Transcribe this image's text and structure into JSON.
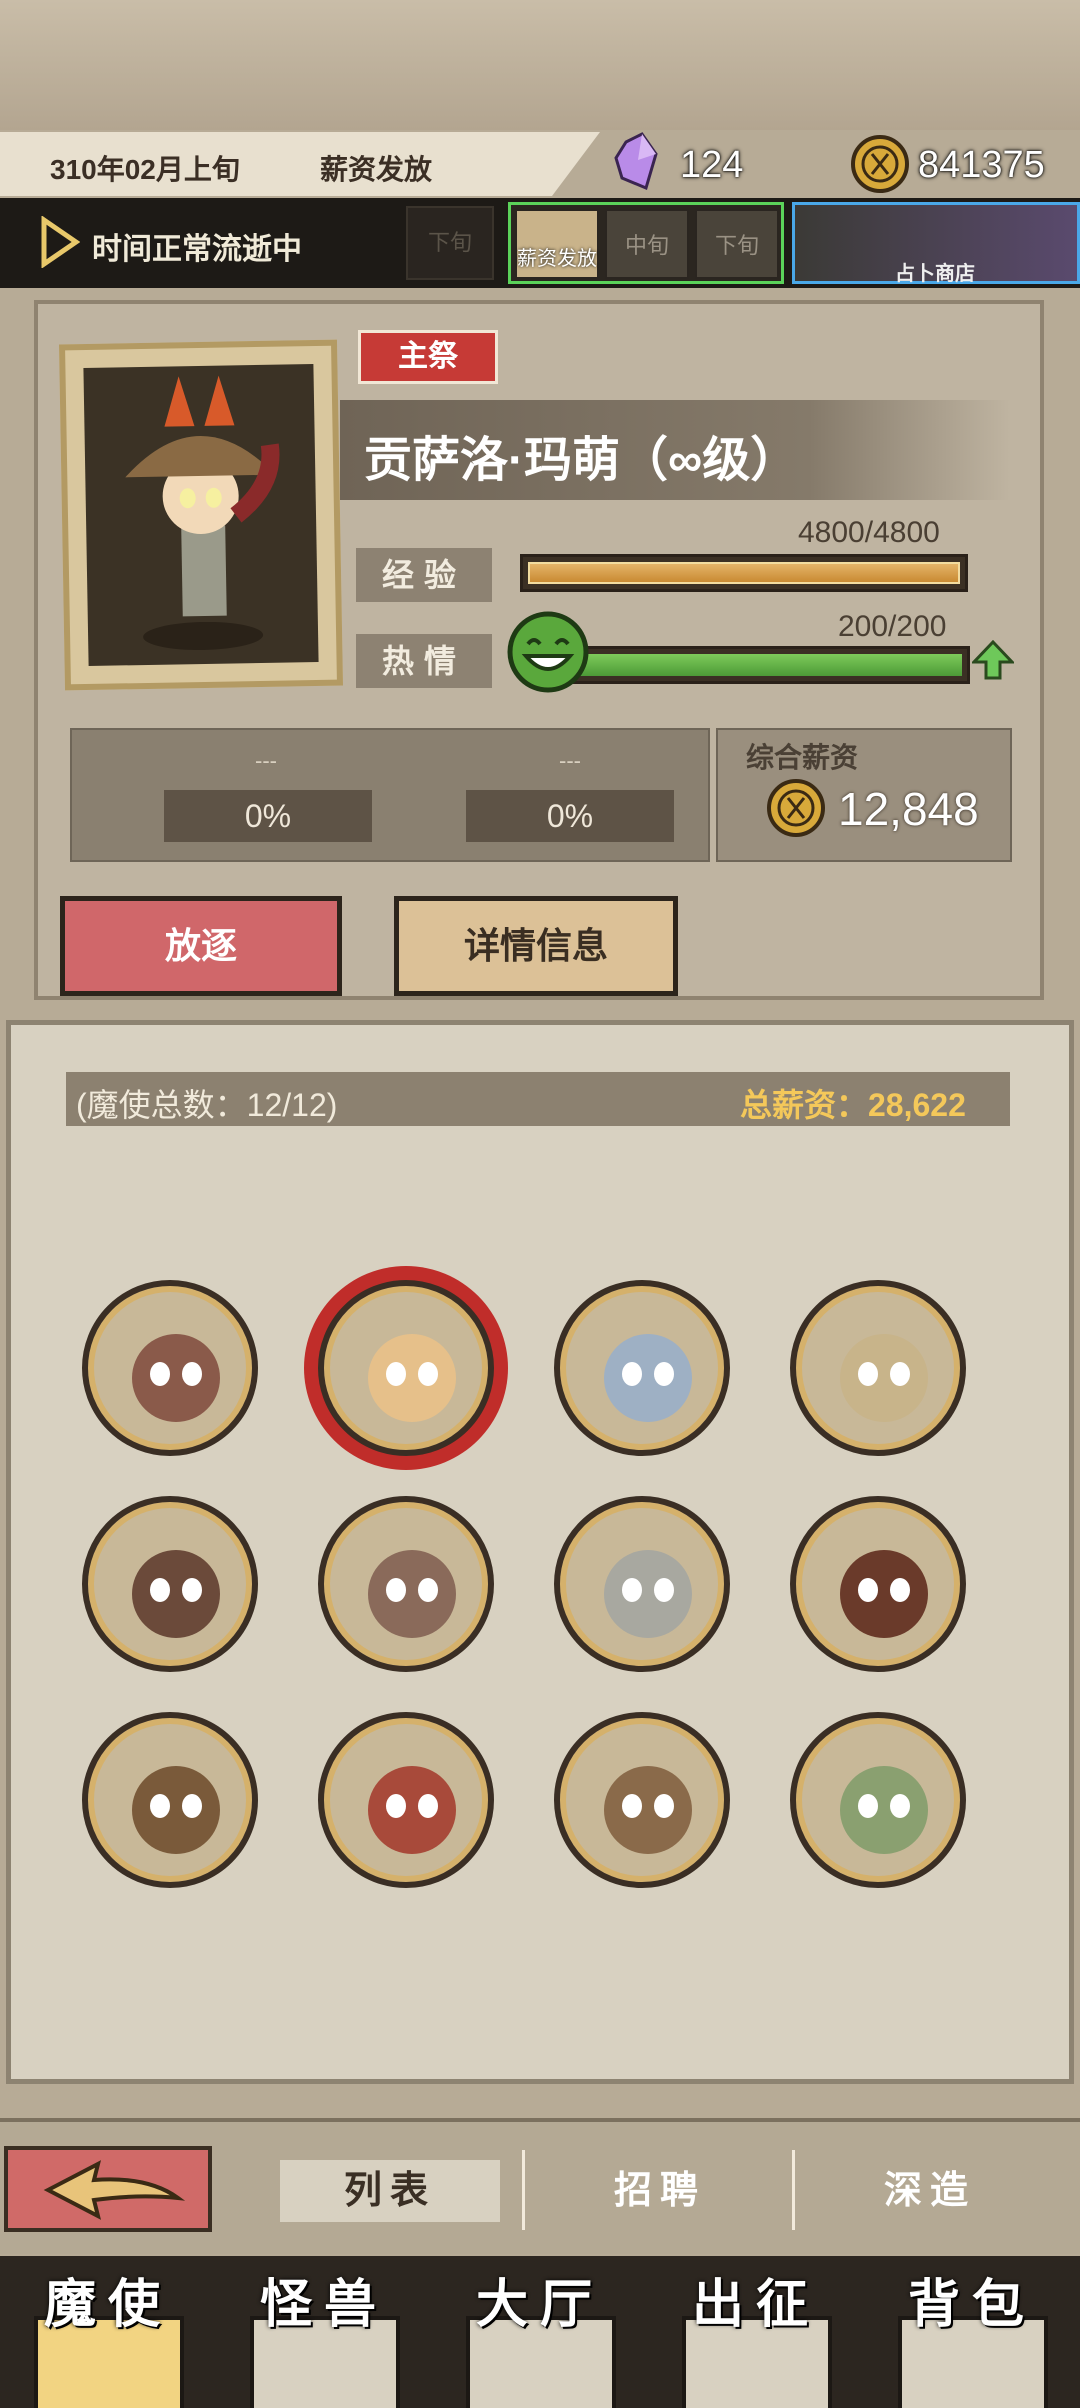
{
  "header": {
    "date": "310年02月上旬",
    "event": "薪资发放",
    "crystal_count": "124",
    "gold_count": "841375"
  },
  "time_bar": {
    "status": "时间正常流逝中",
    "periods": [
      {
        "label": "下旬",
        "state": "disabled"
      },
      {
        "label": "薪资发放",
        "state": "active"
      },
      {
        "label": "中旬",
        "state": "normal"
      },
      {
        "label": "下旬",
        "state": "normal"
      }
    ],
    "shop_label": "占卜商店"
  },
  "character": {
    "badge": "主祭",
    "name": "贡萨洛·玛萌（∞级）",
    "exp_label": "经验",
    "exp_value": "4800/4800",
    "exp_fraction": 1.0,
    "passion_label": "热情",
    "passion_value": "200/200",
    "passion_fraction": 1.0,
    "slot1_name": "---",
    "slot1_pct": "0%",
    "slot2_name": "---",
    "slot2_pct": "0%",
    "salary_title": "综合薪资",
    "salary_value": "12,848",
    "exile_button": "放逐",
    "detail_button": "详情信息"
  },
  "roster": {
    "count_label": "(魔使总数：12/12)",
    "total_salary_label": "总薪资：28,622",
    "selected_index": 1,
    "avatar_colors": [
      "#8a5a4a",
      "#e6c08a",
      "#9eb0c4",
      "#c8b48a",
      "#6b4a3a",
      "#8a6a5a",
      "#a8a8a0",
      "#6a3a2a",
      "#7a5a3a",
      "#a84a3a",
      "#8a6a4a",
      "#8aa070"
    ]
  },
  "subnav": {
    "tabs": [
      "列表",
      "招聘",
      "深造"
    ],
    "active": 0
  },
  "mainnav": {
    "items": [
      "魔使",
      "怪兽",
      "大厅",
      "出征",
      "背包"
    ],
    "active": 0
  },
  "colors": {
    "accent_red": "#c63a36",
    "gold": "#f4c85a",
    "passion_green": "#5bd25a",
    "shop_blue": "#4aa8e8"
  }
}
